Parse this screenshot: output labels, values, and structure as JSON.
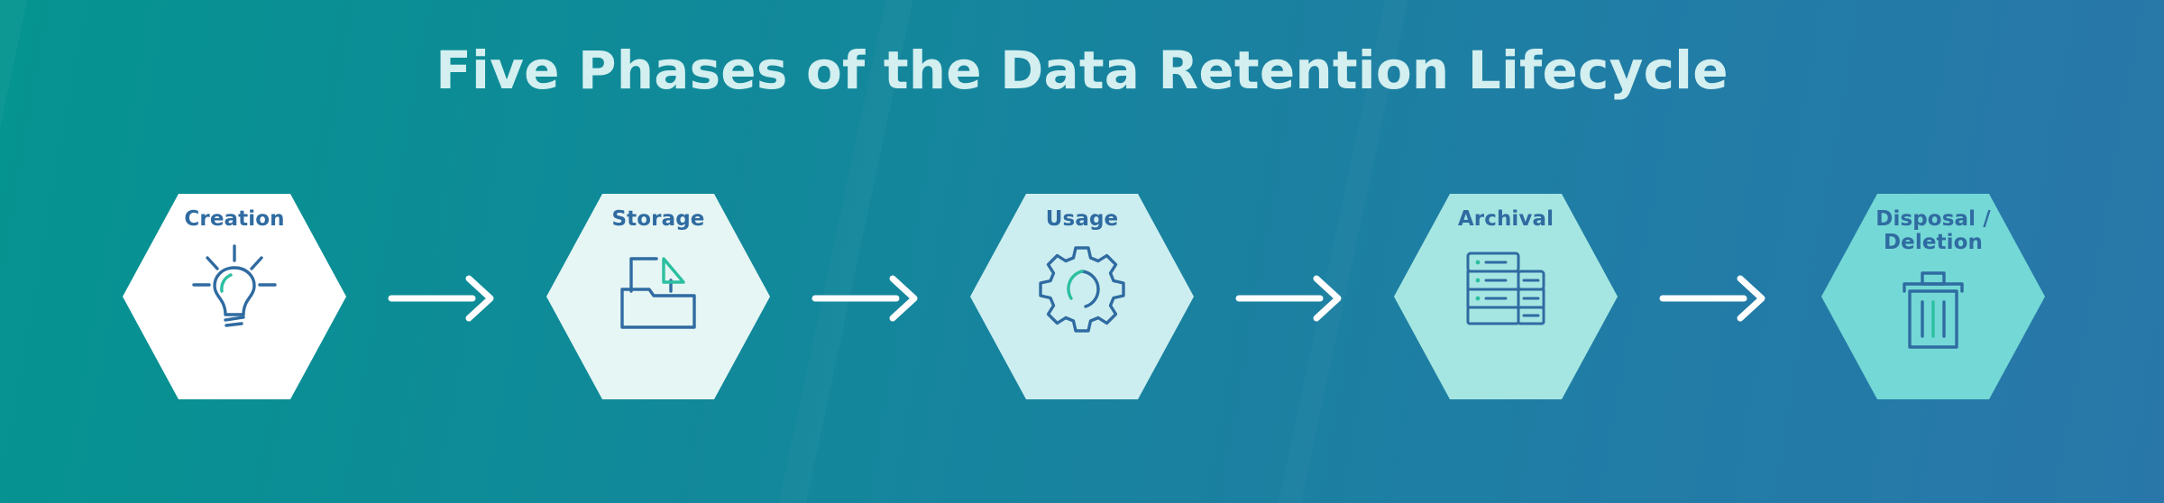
{
  "title": "Five Phases of the Data Retention Lifecycle",
  "colors": {
    "background_left": "#059490",
    "background_right": "#2977a9",
    "title_text": "#d3eff0",
    "label_text": "#2f6ba1",
    "icon_stroke": "#2f6ba1",
    "icon_accent": "#2bbfa0",
    "arrow": "#ffffff"
  },
  "phases": [
    {
      "label": "Creation",
      "icon": "lightbulb-icon",
      "fill": "#ffffff"
    },
    {
      "label": "Storage",
      "icon": "folder-document-icon",
      "fill": "#e6f6f4"
    },
    {
      "label": "Usage",
      "icon": "gear-icon",
      "fill": "#cdeef0"
    },
    {
      "label": "Archival",
      "icon": "server-stack-icon",
      "fill": "#a6e6e2"
    },
    {
      "label_line1": "Disposal /",
      "label_line2": "Deletion",
      "icon": "trash-can-icon",
      "fill": "#74d8d6"
    }
  ],
  "arrows": [
    {
      "name": "arrow-creation-to-storage"
    },
    {
      "name": "arrow-storage-to-usage"
    },
    {
      "name": "arrow-usage-to-archival"
    },
    {
      "name": "arrow-archival-to-disposal"
    }
  ]
}
